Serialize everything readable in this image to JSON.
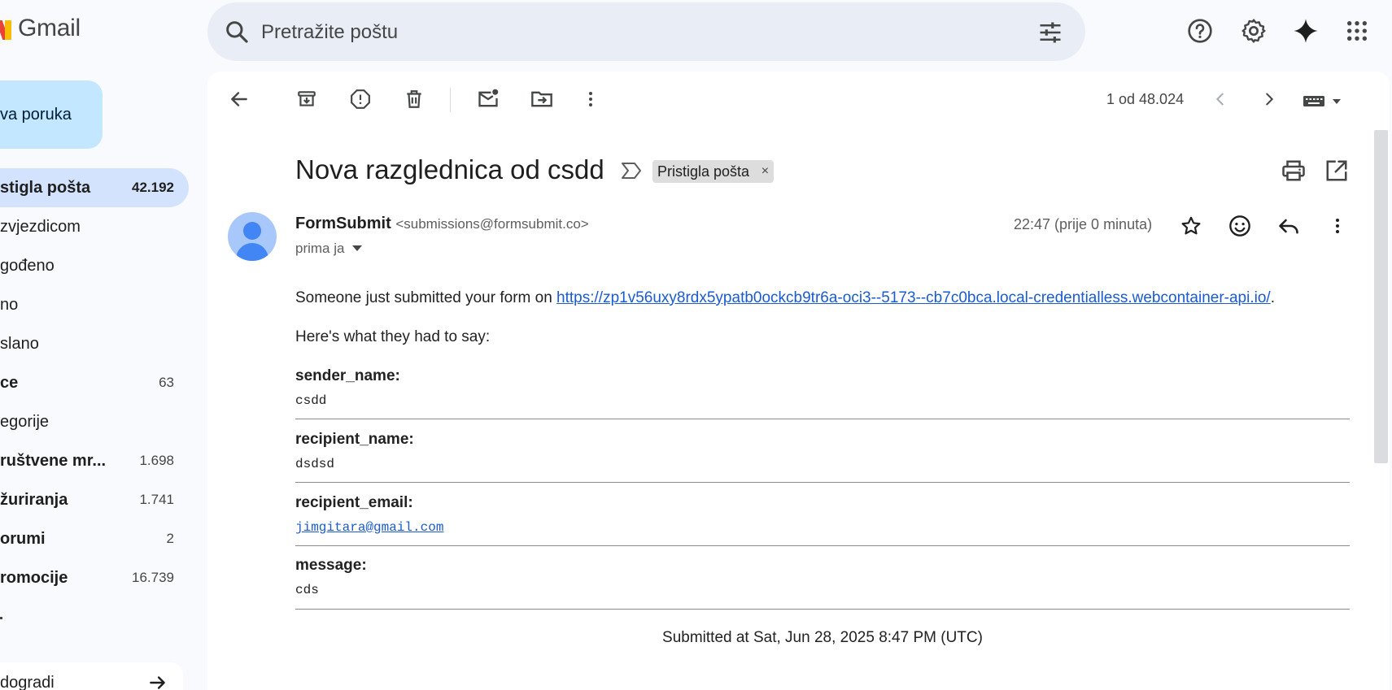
{
  "app": {
    "name": "Gmail"
  },
  "search": {
    "placeholder": "Pretražite poštu"
  },
  "compose": {
    "label": "va poruka"
  },
  "sidebar": {
    "items": [
      {
        "label": "stigla pošta",
        "count": "42.192",
        "active": true,
        "bold": true
      },
      {
        "label": "zvjezdicom",
        "count": "",
        "bold": false
      },
      {
        "label": "gođeno",
        "count": "",
        "bold": false
      },
      {
        "label": "no",
        "count": "",
        "bold": false
      },
      {
        "label": "slano",
        "count": "",
        "bold": false
      },
      {
        "label": "ce",
        "count": "63",
        "bold": true
      },
      {
        "label": "egorije",
        "count": "",
        "bold": false
      },
      {
        "label": "ruštvene mr...",
        "count": "1.698",
        "bold": true
      },
      {
        "label": "žuriranja",
        "count": "1.741",
        "bold": true
      },
      {
        "label": "orumi",
        "count": "2",
        "bold": true
      },
      {
        "label": "romocije",
        "count": "16.739",
        "bold": true
      }
    ],
    "upgrade_label": "dogradi"
  },
  "toolbar": {
    "pager": "1 od 48.024"
  },
  "message": {
    "subject": "Nova razglednica od csdd",
    "label_chip": "Pristigla pošta",
    "label_remove": "×",
    "sender_name": "FormSubmit",
    "sender_email": "<submissions@formsubmit.co>",
    "to": "prima ja",
    "time": "22:47 (prije 0 minuta)",
    "intro_prefix": "Someone just submitted your form on ",
    "intro_link": "https://zp1v56uxy8rdx5ypatb0ockcb9tr6a-oci3--5173--cb7c0bca.local-credentialless.webcontainer-api.io/",
    "intro_suffix": ".",
    "lead": "Here's what they had to say:",
    "fields": [
      {
        "key": "sender_name:",
        "value": "csdd"
      },
      {
        "key": "recipient_name:",
        "value": "dsdsd"
      },
      {
        "key": "recipient_email:",
        "value": "jimgitara@gmail.com"
      },
      {
        "key": "message:",
        "value": "cds"
      }
    ],
    "submitted": "Submitted at Sat, Jun 28, 2025 8:47 PM (UTC)"
  },
  "colors": {
    "background": "#f8fafd",
    "search_bg": "#e9eef6",
    "compose_bg": "#c2e7ff",
    "active_nav_bg": "#d3e3fd",
    "link": "#1a5ccf"
  }
}
